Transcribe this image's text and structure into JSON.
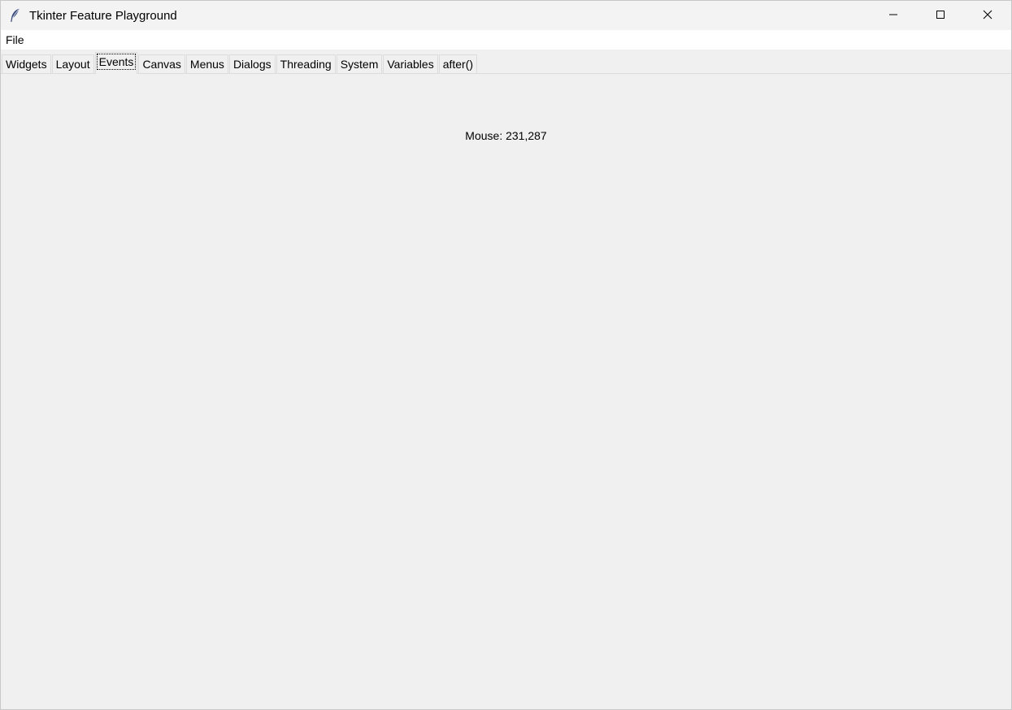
{
  "window": {
    "title": "Tkinter Feature Playground",
    "icon": "feather-icon"
  },
  "controls": {
    "minimize_icon": "minimize-icon",
    "maximize_icon": "maximize-icon",
    "close_icon": "close-icon"
  },
  "menubar": {
    "items": [
      {
        "label": "File"
      }
    ]
  },
  "tabs": [
    {
      "label": "Widgets"
    },
    {
      "label": "Layout"
    },
    {
      "label": "Events"
    },
    {
      "label": "Canvas"
    },
    {
      "label": "Menus"
    },
    {
      "label": "Dialogs"
    },
    {
      "label": "Threading"
    },
    {
      "label": "System"
    },
    {
      "label": "Variables"
    },
    {
      "label": "after()"
    }
  ],
  "active_tab": "Events",
  "events_panel": {
    "mouse_text": "Mouse: 231,287"
  },
  "colors": {
    "background": "#f0f0f0",
    "titlebar": "#f3f3f3",
    "menubar": "#ffffff",
    "close_hover": "#e81123"
  }
}
